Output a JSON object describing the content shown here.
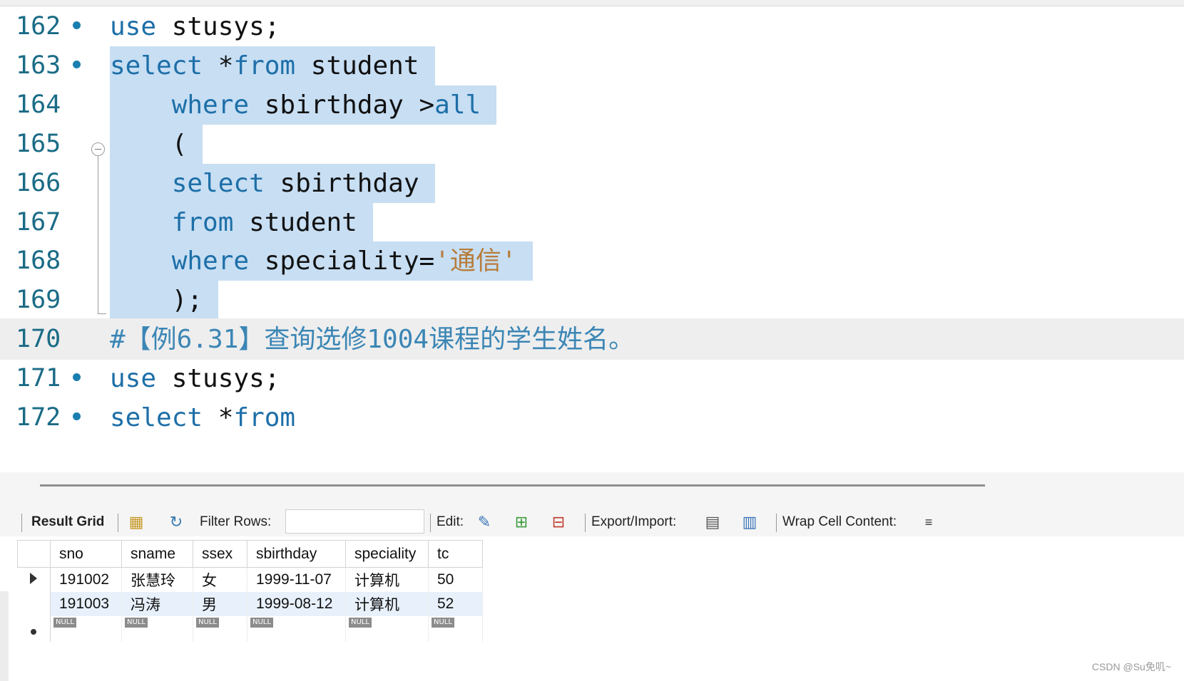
{
  "editor": {
    "lines": [
      {
        "num": "162",
        "bp": true,
        "sel": false,
        "indent": "",
        "parts": [
          {
            "t": "use",
            "c": "kw"
          },
          {
            "t": " stusys;",
            "c": ""
          }
        ]
      },
      {
        "num": "163",
        "bp": true,
        "sel": true,
        "indent": "",
        "parts": [
          {
            "t": "select",
            "c": "kw"
          },
          {
            "t": " *",
            "c": ""
          },
          {
            "t": "from",
            "c": "kw"
          },
          {
            "t": " student",
            "c": ""
          }
        ]
      },
      {
        "num": "164",
        "bp": false,
        "sel": true,
        "indent": "    ",
        "parts": [
          {
            "t": "where",
            "c": "kw"
          },
          {
            "t": " sbirthday >",
            "c": ""
          },
          {
            "t": "all",
            "c": "kw"
          }
        ]
      },
      {
        "num": "165",
        "bp": false,
        "sel": true,
        "indent": "    ",
        "parts": [
          {
            "t": "(",
            "c": ""
          }
        ]
      },
      {
        "num": "166",
        "bp": false,
        "sel": true,
        "indent": "    ",
        "parts": [
          {
            "t": "select",
            "c": "kw"
          },
          {
            "t": " sbirthday",
            "c": ""
          }
        ]
      },
      {
        "num": "167",
        "bp": false,
        "sel": true,
        "indent": "    ",
        "parts": [
          {
            "t": "from",
            "c": "kw"
          },
          {
            "t": " student",
            "c": ""
          }
        ]
      },
      {
        "num": "168",
        "bp": false,
        "sel": true,
        "indent": "    ",
        "parts": [
          {
            "t": "where",
            "c": "kw"
          },
          {
            "t": " speciality=",
            "c": ""
          },
          {
            "t": "'通信'",
            "c": "str"
          }
        ]
      },
      {
        "num": "169",
        "bp": false,
        "sel": true,
        "indent": "    ",
        "parts": [
          {
            "t": ");",
            "c": ""
          }
        ]
      },
      {
        "num": "170",
        "bp": false,
        "sel": false,
        "current": true,
        "indent": "",
        "parts": [
          {
            "t": "#【例6.31】查询选修1004课程的学生姓名。",
            "c": "cmt"
          }
        ]
      },
      {
        "num": "171",
        "bp": true,
        "sel": false,
        "indent": "",
        "parts": [
          {
            "t": "use",
            "c": "kw"
          },
          {
            "t": " stusys;",
            "c": ""
          }
        ]
      },
      {
        "num": "172",
        "bp": true,
        "sel": false,
        "indent": "",
        "parts": [
          {
            "t": "select",
            "c": "kw"
          },
          {
            "t": " *",
            "c": ""
          },
          {
            "t": "from",
            "c": "kw"
          }
        ]
      }
    ]
  },
  "toolbar": {
    "result_grid_label": "Result Grid",
    "filter_rows_label": "Filter Rows:",
    "filter_value": "",
    "edit_label": "Edit:",
    "export_import_label": "Export/Import:",
    "wrap_label": "Wrap Cell Content:"
  },
  "grid": {
    "columns": [
      "sno",
      "sname",
      "ssex",
      "sbirthday",
      "speciality",
      "tc"
    ],
    "rows": [
      [
        "191002",
        "张慧玲",
        "女",
        "1999-11-07",
        "计算机",
        "50"
      ],
      [
        "191003",
        "冯涛",
        "男",
        "1999-08-12",
        "计算机",
        "52"
      ]
    ],
    "null_label": "NULL"
  },
  "watermark": "CSDN @Su免叽~"
}
